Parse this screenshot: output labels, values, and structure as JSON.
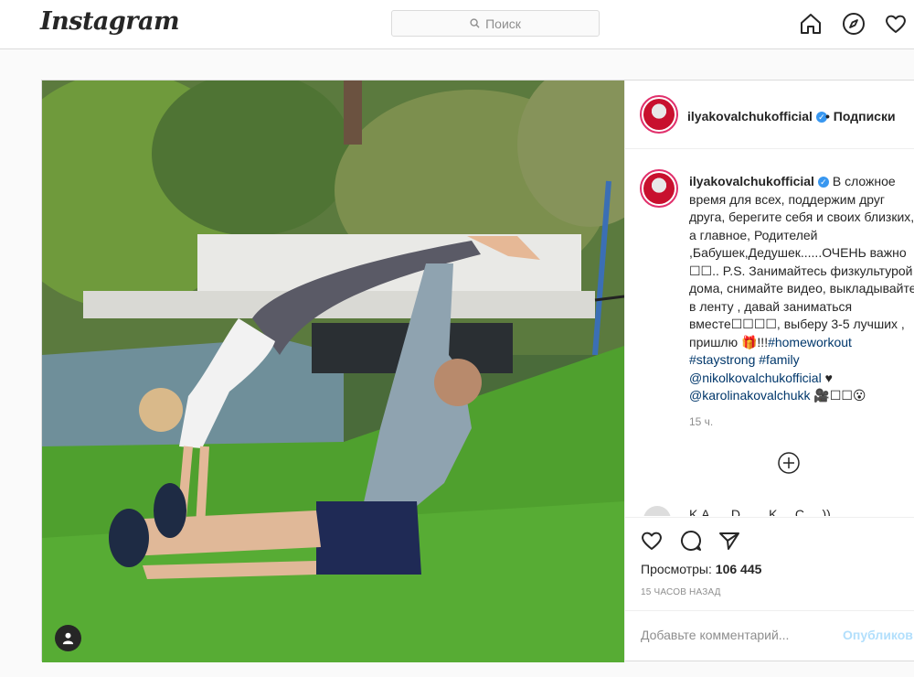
{
  "app": {
    "logo": "Instagram"
  },
  "search": {
    "placeholder": "Поиск"
  },
  "nav": {
    "icons": [
      "home-icon",
      "explore-compass-icon",
      "activity-heart-icon"
    ]
  },
  "post": {
    "author": "ilyakovalchukofficial",
    "verified": true,
    "follow_label": "Подписки",
    "separator": "•",
    "caption_parts": {
      "text1": "В сложное время для всех, поддержим друг друга, берегите себя и своих близких, а главное, Родителей ,Бабушек,Дедушек......ОЧЕНЬ важно ☐☐.. P.S. Занимайтесь физкультурой дома, снимайте видео, выкладывайте в ленту , давай заниматься вместе☐☐☐☐, выберу 3-5 лучших , пришлю 🎁!!!",
      "tag1": "#homeworkout",
      "tag2": "#staystrong",
      "tag3": "#family",
      "mention1": "@nikolkovalchukofficial",
      "text2": " ♥ ",
      "mention2": "@karolinakovalchukk",
      "text3": " 🎥☐☐😮"
    },
    "caption_time": "15 ч.",
    "next_comment_text": "K.A. ... D... ... K ... C ... ))",
    "views_label": "Просмотры:",
    "views_count": "106 445",
    "posted_ago": "15 ЧАСОВ НАЗАД",
    "comment_placeholder": "Добавьте комментарий...",
    "publish_label": "Опубликов"
  },
  "colors": {
    "accent": "#3897f0",
    "link": "#00376b",
    "publish_disabled": "#b2dffc",
    "border": "#dbdbdb"
  }
}
